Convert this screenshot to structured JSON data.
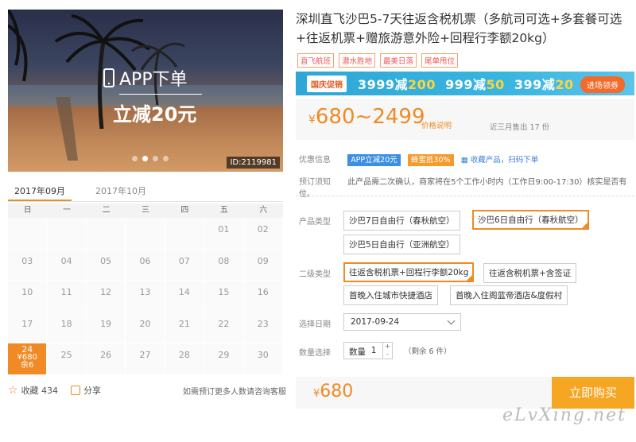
{
  "hero": {
    "app_label": "APP下单",
    "discount": "立减20元",
    "id_tag": "ID:2119981",
    "slides": 4,
    "active_slide": 1
  },
  "calendar": {
    "months": [
      "2017年09月",
      "2017年10月"
    ],
    "weekdays": [
      "日",
      "一",
      "二",
      "三",
      "四",
      "五",
      "六"
    ],
    "rows": [
      [
        "",
        "",
        "",
        "",
        "",
        "01",
        "02"
      ],
      [
        "03",
        "04",
        "05",
        "06",
        "07",
        "08",
        "09"
      ],
      [
        "10",
        "11",
        "12",
        "13",
        "14",
        "15",
        "16"
      ],
      [
        "17",
        "18",
        "19",
        "20",
        "21",
        "22",
        "23"
      ],
      [
        "24",
        "25",
        "26",
        "27",
        "28",
        "29",
        "30"
      ]
    ],
    "selected": {
      "day": "24",
      "price": "¥680",
      "stock": "余6"
    }
  },
  "actions": {
    "favorite": "收藏 434",
    "share": "分享",
    "note": "如需预订更多人数请咨询客服"
  },
  "product": {
    "title": "深圳直飞沙巴5-7天往返含税机票（多航司可选+多套餐可选+往返机票+赠旅游意外险+回程行李额20kg）",
    "tags": [
      "直飞航班",
      "潜水胜地",
      "最美日落",
      "尾单甩位"
    ]
  },
  "promo": {
    "label": "国庆促销",
    "offers": [
      {
        "pre": "3999减",
        "amt": "200"
      },
      {
        "pre": "999减",
        "amt": "50"
      },
      {
        "pre": "399减",
        "amt": "20"
      }
    ],
    "button": "进场领券"
  },
  "price": {
    "currency": "¥",
    "range": "680~2499",
    "explain": "价格说明",
    "sold": "近三月售出 17 份"
  },
  "info": {
    "discount_label": "优惠信息",
    "badge_app": "APP立减20元",
    "badge_honey": "蜂蜜抵30%",
    "qr_text": "收藏产品，扫码下单",
    "notice_label": "预订须知",
    "notice": "此产品需二次确认，商家将在5个工作小时内（工作日9:00-17:30）核实是否有位。"
  },
  "options": {
    "type_label": "产品类型",
    "types": [
      "沙巴7日自由行（春秋航空）",
      "沙巴6日自由行（春秋航空）",
      "沙巴5日自由行（亚洲航空）"
    ],
    "sub_label": "二级类型",
    "subs": [
      "往返含税机票+回程行李额20kg",
      "往返含税机票+含签证",
      "首晚入住城市快捷酒店",
      "首晚入住阁蓝帝酒店&度假村"
    ],
    "date_label": "选择日期",
    "date_value": "2017-09-24",
    "qty_label": "数量选择",
    "qty_text": "数量",
    "qty_value": "1",
    "remain": "（剩余 6 件）"
  },
  "buy": {
    "currency": "¥",
    "price": "680",
    "button": "立即购买"
  },
  "watermark": "eLvXing.net"
}
